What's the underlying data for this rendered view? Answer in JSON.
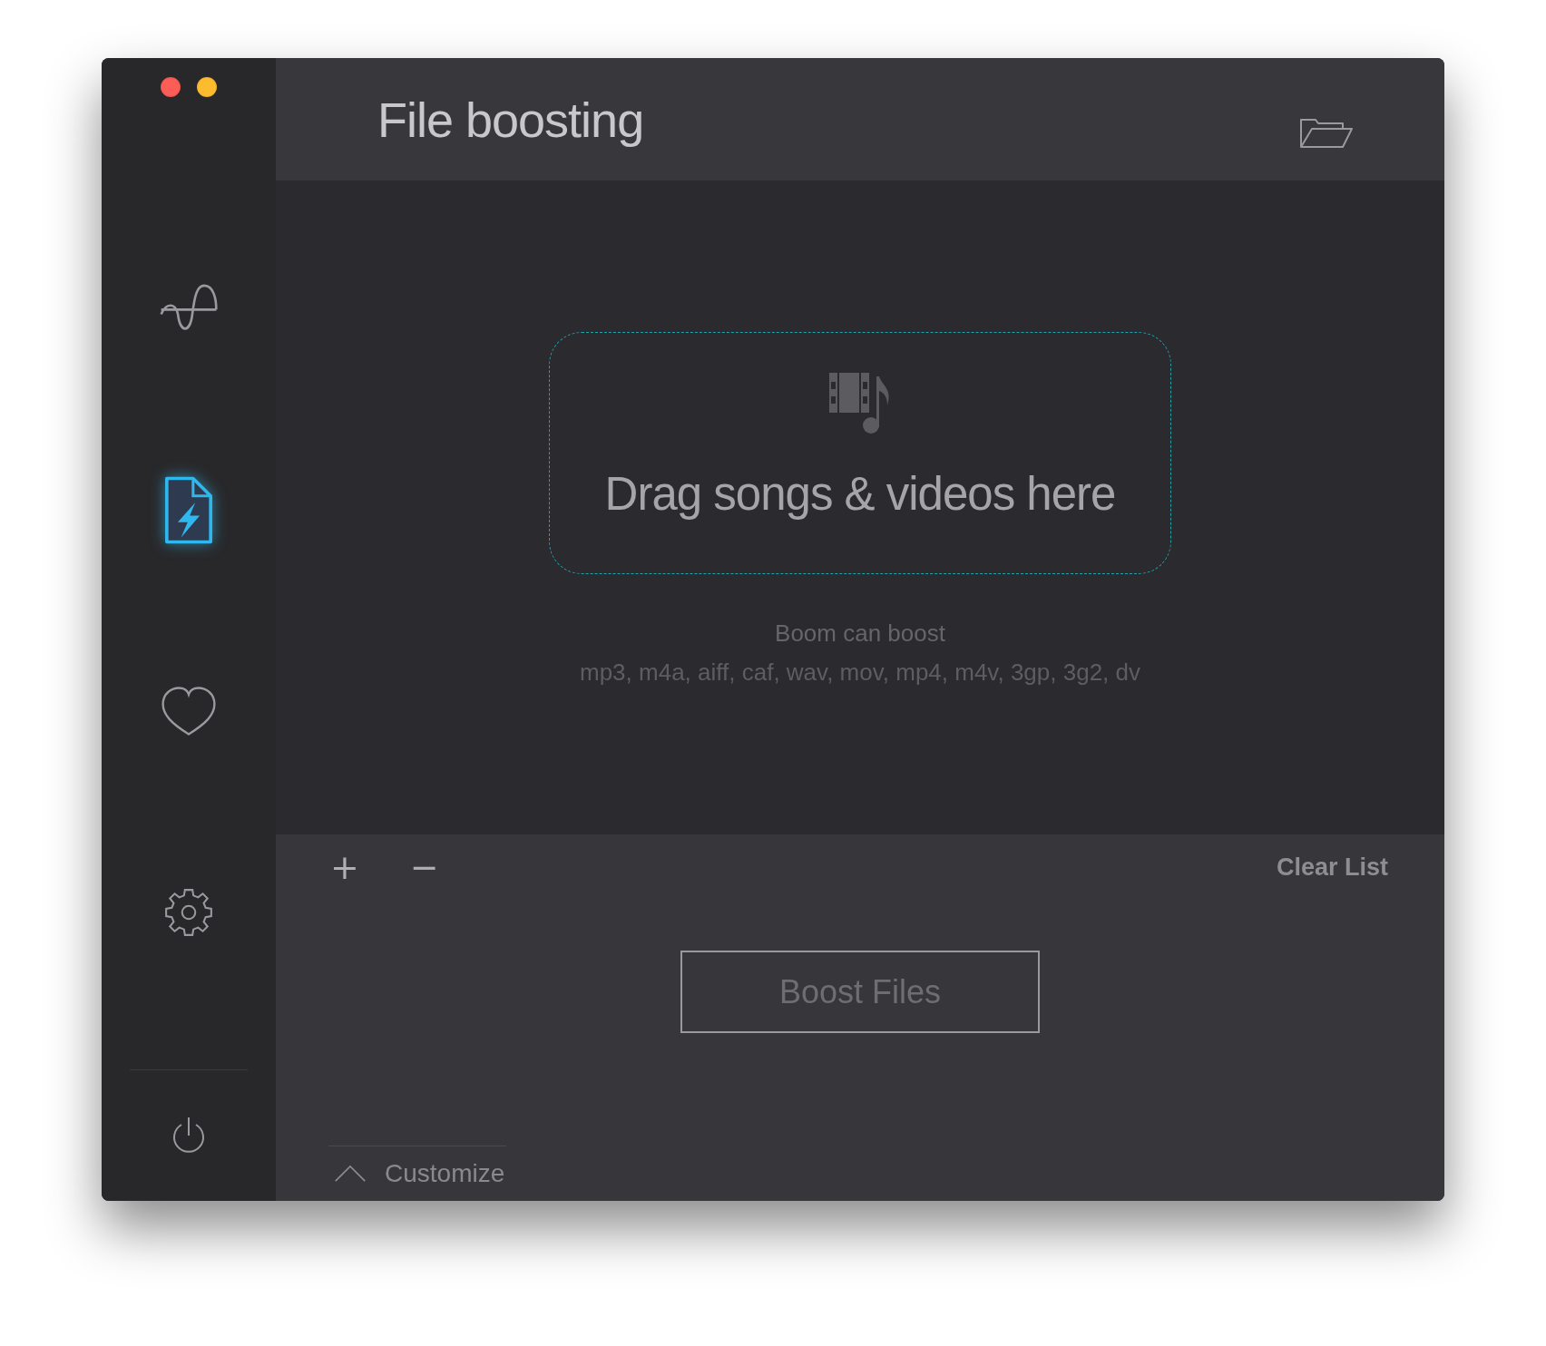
{
  "window": {
    "controls": [
      {
        "kind": "close",
        "color": "#fc5d56"
      },
      {
        "kind": "minimize",
        "color": "#fdbb2e"
      }
    ]
  },
  "sidebar": {
    "items": [
      {
        "kind": "equalizer",
        "selected": false
      },
      {
        "kind": "file-boost",
        "selected": true
      },
      {
        "kind": "favorites",
        "selected": false
      },
      {
        "kind": "settings",
        "selected": false
      }
    ]
  },
  "header": {
    "title": "File boosting"
  },
  "drop_zone": {
    "message": "Drag songs & videos here",
    "caption": "Boom can boost",
    "formats": "mp3, m4a, aiff, caf, wav, mov, mp4, m4v, 3gp, 3g2, dv"
  },
  "toolbar": {
    "add": "+",
    "remove": "−",
    "clear": "Clear List"
  },
  "boost_button": {
    "label": "Boost Files",
    "disabled": true
  },
  "customize": {
    "label": "Customize",
    "expanded": false
  }
}
